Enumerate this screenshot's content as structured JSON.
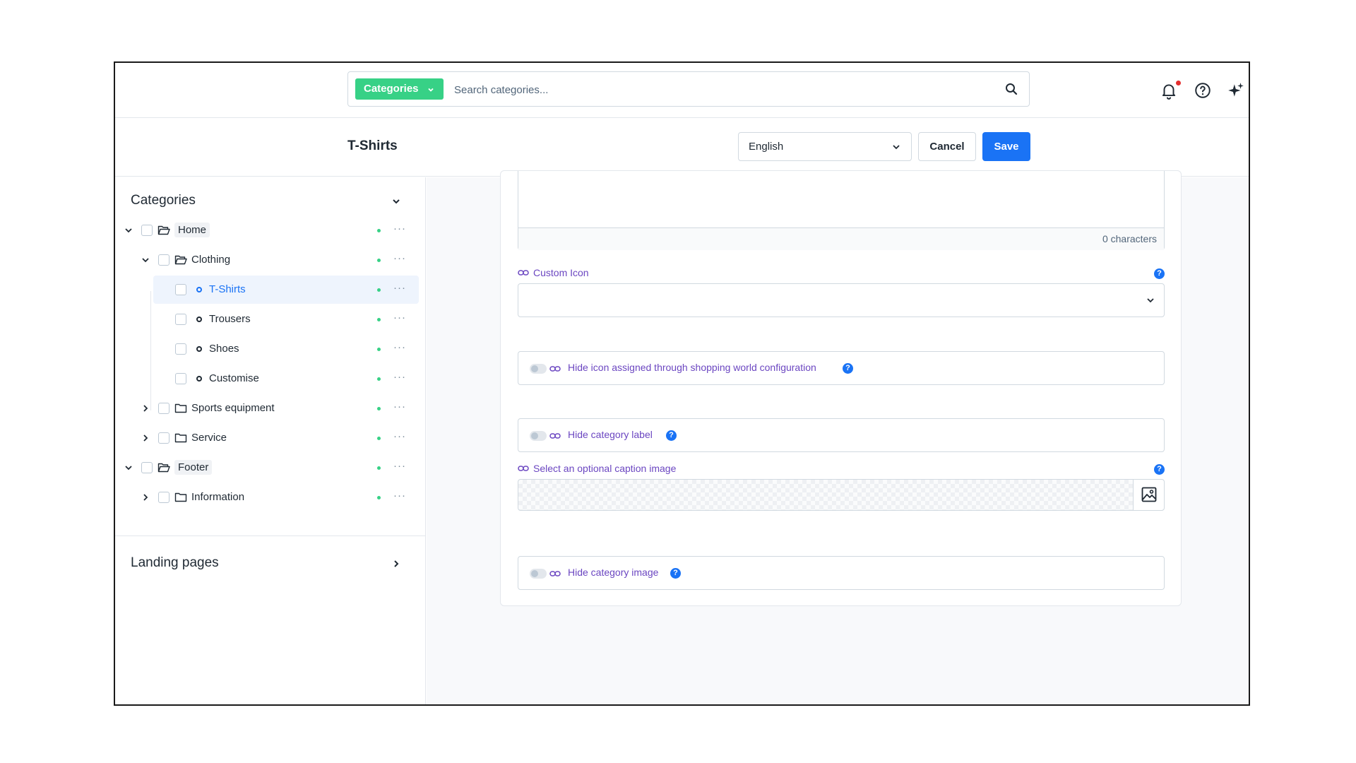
{
  "search": {
    "type_label": "Categories",
    "placeholder": "Search categories..."
  },
  "header": {
    "title": "T-Shirts",
    "language": "English",
    "cancel_label": "Cancel",
    "save_label": "Save"
  },
  "sidebar": {
    "heading": "Categories",
    "tree": [
      {
        "label": "Home",
        "level": 0,
        "expanded": true
      },
      {
        "label": "Clothing",
        "level": 1,
        "expanded": true
      },
      {
        "label": "T-Shirts",
        "level": 2,
        "active": true
      },
      {
        "label": "Trousers",
        "level": 2
      },
      {
        "label": "Shoes",
        "level": 2
      },
      {
        "label": "Customise",
        "level": 2
      },
      {
        "label": "Sports equipment",
        "level": 1,
        "expanded": false
      },
      {
        "label": "Service",
        "level": 1,
        "expanded": false
      },
      {
        "label": "Footer",
        "level": 0,
        "expanded": true
      },
      {
        "label": "Information",
        "level": 1,
        "expanded": false
      }
    ],
    "more_label": "···",
    "landing_pages": "Landing pages"
  },
  "form": {
    "char_count": "0 characters",
    "custom_icon_label": "Custom Icon",
    "hide_icon_label": "Hide icon assigned through shopping world configuration",
    "hide_label_label": "Hide category label",
    "caption_image_label": "Select an optional caption image",
    "hide_image_label": "Hide category image",
    "help_glyph": "?"
  },
  "colors": {
    "accent": "#1a73f5",
    "green": "#37d186",
    "purple": "#6b46c1",
    "notification": "#e42d2d"
  }
}
